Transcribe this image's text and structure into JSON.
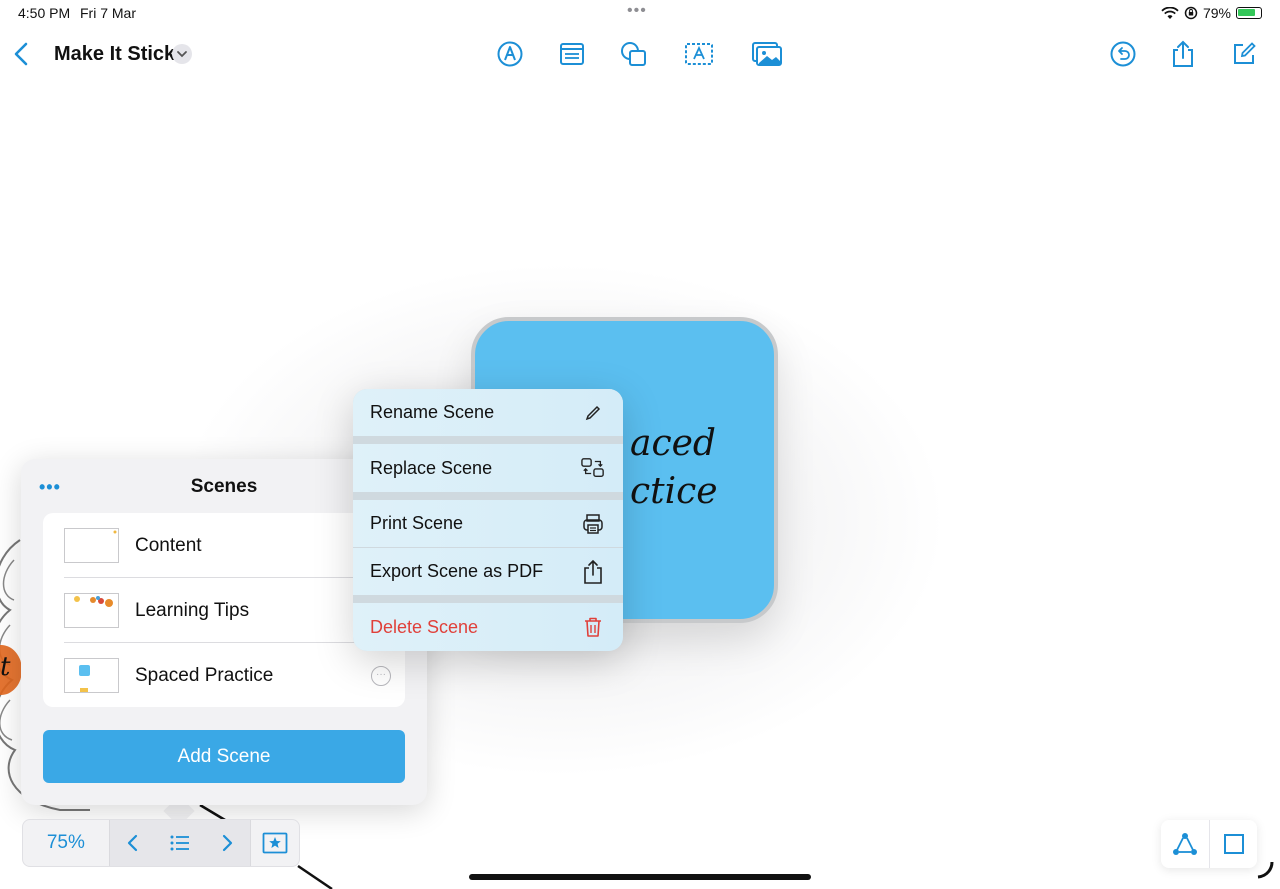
{
  "status_bar": {
    "time": "4:50 PM",
    "date": "Fri 7 Mar",
    "center_dots": "•••",
    "battery_percent": "79%",
    "battery_level": 0.79,
    "icons": [
      "wifi-icon",
      "orientation-lock-icon",
      "battery-charging-icon"
    ]
  },
  "toolbar": {
    "document_title": "Make It Stick",
    "icons": [
      "back-chevron-icon",
      "title-chevron-down-icon",
      "pen-icon",
      "sticky-note-icon",
      "shapes-icon",
      "text-box-icon",
      "media-icon",
      "undo-icon",
      "share-icon",
      "compose-icon"
    ]
  },
  "canvas": {
    "sticky_text": "aced\nctice",
    "partial_text": "t"
  },
  "scenes_panel": {
    "more_label": "•••",
    "title": "Scenes",
    "items": [
      {
        "label": "Content"
      },
      {
        "label": "Learning Tips"
      },
      {
        "label": "Spaced Practice",
        "more": "···"
      }
    ],
    "add_button": "Add Scene"
  },
  "context_menu": {
    "items": [
      {
        "label": "Rename Scene",
        "icon": "pencil-icon"
      },
      {
        "label": "Replace Scene",
        "icon": "swap-icon"
      },
      {
        "label": "Print Scene",
        "icon": "printer-icon"
      },
      {
        "label": "Export Scene as PDF",
        "icon": "share-export-icon"
      },
      {
        "label": "Delete Scene",
        "icon": "trash-icon",
        "danger": true
      }
    ]
  },
  "bottom_bar": {
    "zoom": "75%",
    "icons": [
      "previous-scene-icon",
      "scene-list-icon",
      "next-scene-icon",
      "star-frame-icon"
    ]
  },
  "right_tools": {
    "icons": [
      "connector-icon",
      "frame-icon"
    ]
  },
  "colors": {
    "accent": "#1c8fd6",
    "sticky": "#5bbff0",
    "danger": "#e0403a",
    "add_button": "#3aa8e6"
  }
}
